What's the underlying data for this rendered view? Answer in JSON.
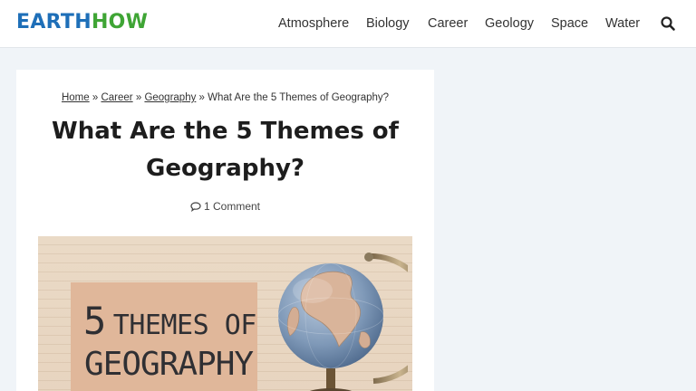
{
  "header": {
    "logo_part1": "EARTH",
    "logo_part2": "HOW",
    "nav": [
      "Atmosphere",
      "Biology",
      "Career",
      "Geology",
      "Space",
      "Water"
    ],
    "search_icon": "search-icon"
  },
  "breadcrumb": {
    "items": [
      "Home",
      "Career",
      "Geography"
    ],
    "separator": "»",
    "current": "What Are the 5 Themes of Geography?"
  },
  "article": {
    "title": "What Are the 5 Themes of Geography?",
    "comments_label": "1 Comment",
    "comments_icon": "comment-icon",
    "hero": {
      "line1_number": "5",
      "line1_text": "THEMES OF",
      "line2_text": "GEOGRAPHY"
    }
  },
  "colors": {
    "logo_blue": "#1e6fb8",
    "logo_green": "#3fa535",
    "page_background": "#f0f4f8",
    "hero_background": "#eadac6",
    "hero_box": "#e0b79a"
  }
}
